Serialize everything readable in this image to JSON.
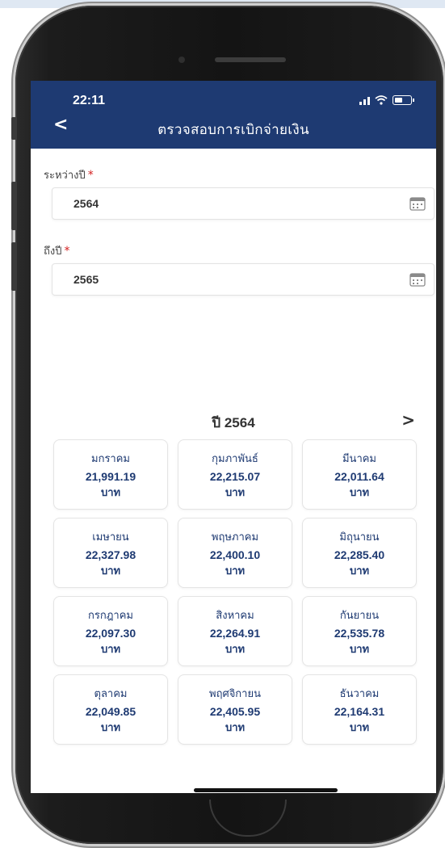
{
  "status": {
    "time": "22:11"
  },
  "header": {
    "back_label": "<",
    "title": "ตรวจสอบการเบิกจ่ายเงิน"
  },
  "form": {
    "from_label": "ระหว่างปี",
    "from_value": "2564",
    "to_label": "ถึงปี",
    "to_value": "2565",
    "required_mark": "*"
  },
  "year_nav": {
    "year_label": "ปี 2564",
    "next_label": ">"
  },
  "unit": "บาท",
  "months": [
    {
      "name": "มกราคม",
      "amount": "21,991.19"
    },
    {
      "name": "กุมภาพันธ์",
      "amount": "22,215.07"
    },
    {
      "name": "มีนาคม",
      "amount": "22,011.64"
    },
    {
      "name": "เมษายน",
      "amount": "22,327.98"
    },
    {
      "name": "พฤษภาคม",
      "amount": "22,400.10"
    },
    {
      "name": "มิถุนายน",
      "amount": "22,285.40"
    },
    {
      "name": "กรกฎาคม",
      "amount": "22,097.30"
    },
    {
      "name": "สิงหาคม",
      "amount": "22,264.91"
    },
    {
      "name": "กันยายน",
      "amount": "22,535.78"
    },
    {
      "name": "ตุลาคม",
      "amount": "22,049.85"
    },
    {
      "name": "พฤศจิกายน",
      "amount": "22,405.95"
    },
    {
      "name": "ธันวาคม",
      "amount": "22,164.31"
    }
  ],
  "icons": {
    "back": "chevron-left-icon",
    "calendar": "calendar-icon",
    "next": "chevron-right-icon",
    "signal": "signal-icon",
    "wifi": "wifi-icon",
    "battery": "battery-icon"
  },
  "colors": {
    "header_bg": "#1e3a72",
    "accent_text": "#1e3a72",
    "required": "#d32020"
  }
}
